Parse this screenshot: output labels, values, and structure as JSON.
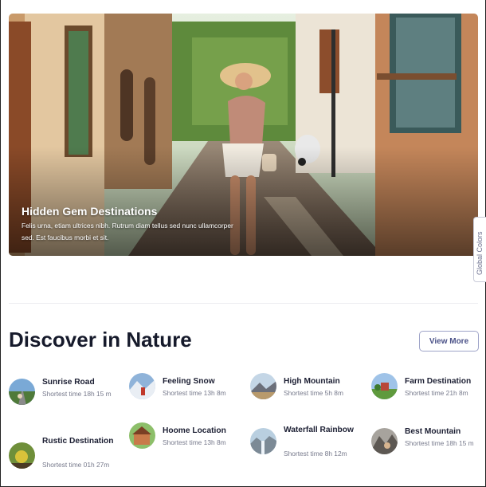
{
  "hero": {
    "title": "Hidden Gem Destinations",
    "description": "Felis urna, etiam ultrices nibh. Rutrum diam tellus sed nunc ullamcorper sed. Est faucibus morbi et sit."
  },
  "side_tab": {
    "label": "Global Colors"
  },
  "section": {
    "title": "Discover in Nature",
    "view_more_label": "View More"
  },
  "destinations": [
    {
      "name": "Sunrise Road",
      "meta": "Shortest time 18h 15 m",
      "icon": "road-thumbnail"
    },
    {
      "name": "Feeling Snow",
      "meta": "Shortest time 13h 8m",
      "icon": "snow-thumbnail"
    },
    {
      "name": "High Mountain",
      "meta": "Shortest time 5h 8m",
      "icon": "mountain-thumbnail"
    },
    {
      "name": "Farm Destination",
      "meta": "Shortest time 21h 8m",
      "icon": "farm-thumbnail"
    },
    {
      "name": "Rustic Destination",
      "meta": "Shortest time 01h 27m",
      "icon": "rustic-thumbnail"
    },
    {
      "name": "Hoome Location",
      "meta": "Shortest time 13h 8m",
      "icon": "home-thumbnail"
    },
    {
      "name": "Waterfall Rainbow",
      "meta": "Shortest time 8h 12m",
      "icon": "waterfall-thumbnail"
    },
    {
      "name": "Best Mountain",
      "meta": "Shortest time 18h 15 m",
      "icon": "peak-thumbnail"
    }
  ]
}
